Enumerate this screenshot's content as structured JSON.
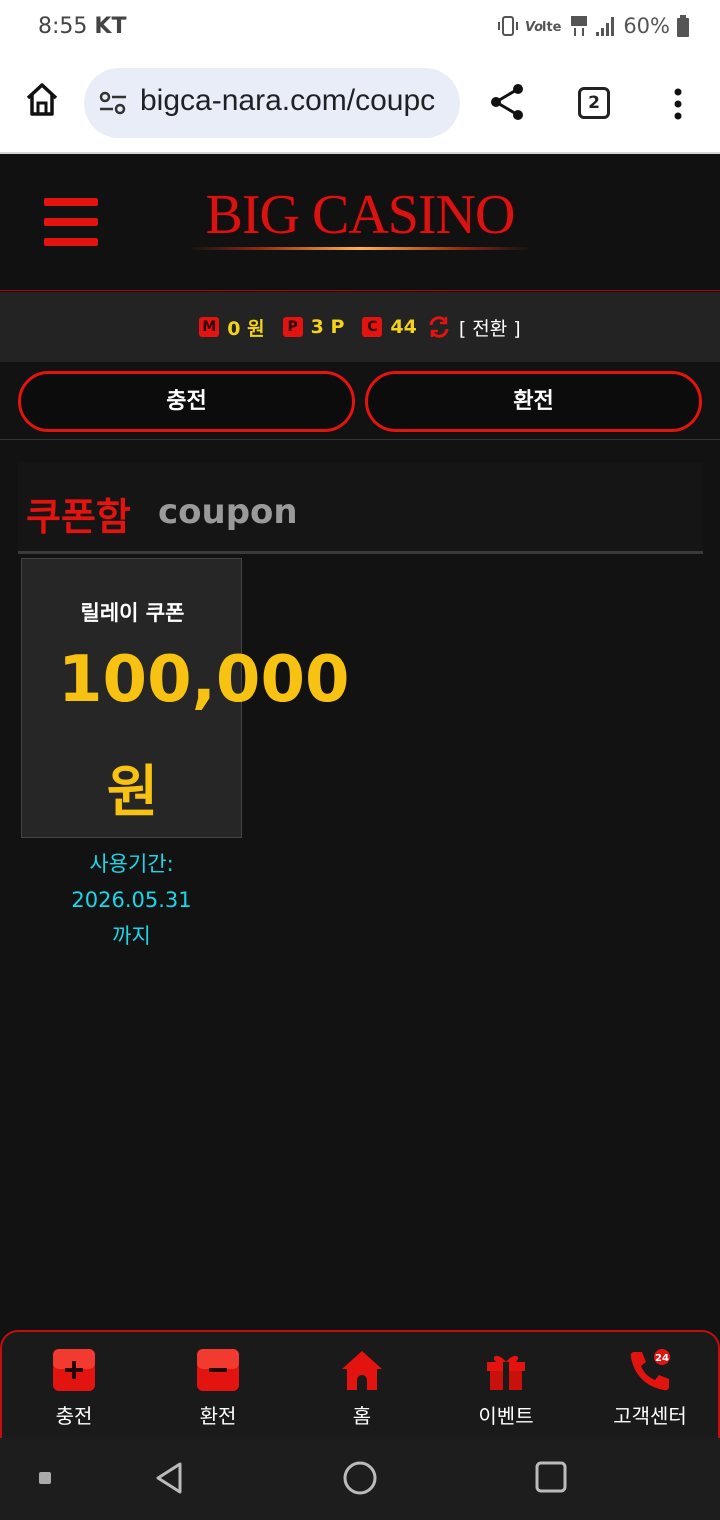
{
  "status_bar": {
    "time": "8:55",
    "carrier": "KT",
    "battery": "60%"
  },
  "browser": {
    "url": "bigca-nara.com/coupc",
    "tab_count": "2"
  },
  "site": {
    "logo": "BIG CASINO"
  },
  "balance": {
    "m_badge": "M",
    "m_value": "0 원",
    "p_badge": "P",
    "p_value": "3 P",
    "c_badge": "C",
    "c_value": "44",
    "switch_label": "[ 전환 ]"
  },
  "actions": {
    "charge": "충전",
    "exchange": "환전"
  },
  "coupon_box": {
    "title": "쿠폰함",
    "subtitle": "coupon"
  },
  "coupons": [
    {
      "name": "릴레이 쿠폰",
      "amount": "100,000",
      "unit": "원",
      "expiry_line1": "사용기간:",
      "expiry_line2": "2026.05.31",
      "expiry_line3": "까지"
    }
  ],
  "bottom_nav": [
    {
      "label": "충전",
      "icon": "plus-icon"
    },
    {
      "label": "환전",
      "icon": "minus-icon"
    },
    {
      "label": "홈",
      "icon": "home-icon"
    },
    {
      "label": "이벤트",
      "icon": "gift-icon"
    },
    {
      "label": "고객센터",
      "icon": "phone-24-icon"
    }
  ],
  "colors": {
    "brand_red": "#e3140f",
    "gold": "#f7c211",
    "cyan": "#1ad6e8",
    "bg": "#121213"
  }
}
